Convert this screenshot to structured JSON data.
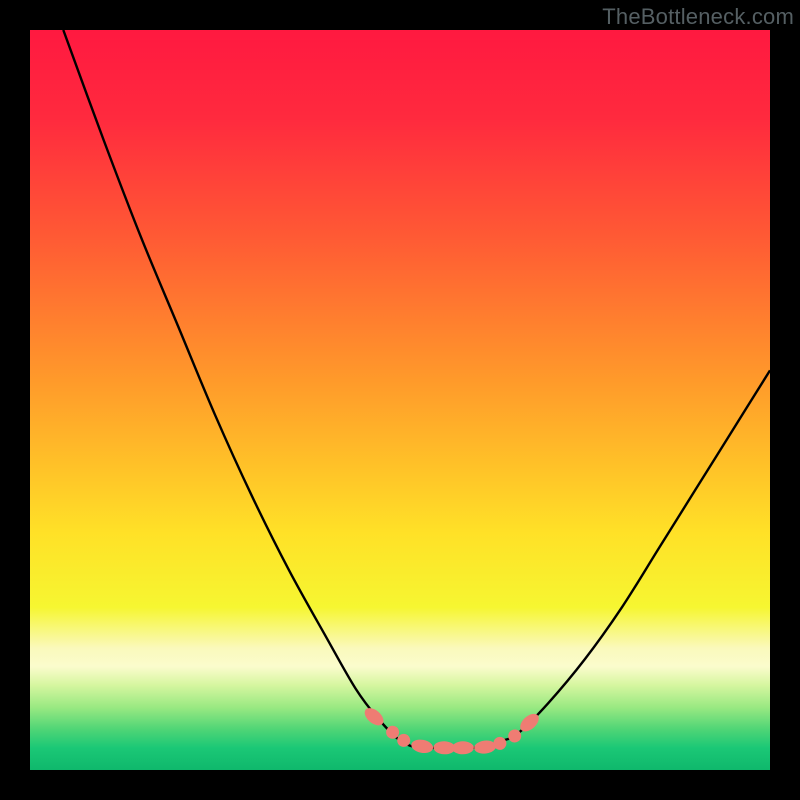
{
  "watermark": "TheBottleneck.com",
  "colors": {
    "frame": "#000000",
    "gradient_stops": [
      {
        "offset": 0.0,
        "color": "#ff1940"
      },
      {
        "offset": 0.12,
        "color": "#ff2a3e"
      },
      {
        "offset": 0.28,
        "color": "#ff5a34"
      },
      {
        "offset": 0.48,
        "color": "#ff9c2a"
      },
      {
        "offset": 0.68,
        "color": "#ffe127"
      },
      {
        "offset": 0.78,
        "color": "#f6f631"
      },
      {
        "offset": 0.835,
        "color": "#faf9bb"
      },
      {
        "offset": 0.86,
        "color": "#fbfccd"
      },
      {
        "offset": 0.885,
        "color": "#d6f6a0"
      },
      {
        "offset": 0.915,
        "color": "#9ae982"
      },
      {
        "offset": 0.945,
        "color": "#4fd576"
      },
      {
        "offset": 0.97,
        "color": "#1bc876"
      },
      {
        "offset": 1.0,
        "color": "#0fb86c"
      }
    ],
    "curve": "#000000",
    "marker_fill": "#ef7c73",
    "marker_stroke": "#c45a55"
  },
  "chart_data": {
    "type": "line",
    "title": "",
    "xlabel": "",
    "ylabel": "",
    "xlim": [
      0,
      100
    ],
    "ylim": [
      0,
      100
    ],
    "series": [
      {
        "name": "bottleneck-curve",
        "x": [
          4.5,
          10,
          15,
          20,
          25,
          30,
          35,
          40,
          44,
          47,
          50,
          52.5,
          55,
          60,
          64,
          66,
          70,
          75,
          80,
          85,
          90,
          95,
          100
        ],
        "y": [
          100,
          85,
          72,
          60,
          48,
          37,
          27,
          18,
          11,
          7,
          4,
          3,
          3,
          3,
          4,
          5,
          9,
          15,
          22,
          30,
          38,
          46,
          54
        ]
      }
    ],
    "markers": {
      "name": "highlight-points",
      "x": [
        46.5,
        49,
        50.5,
        53,
        56,
        58.5,
        61.5,
        63.5,
        65.5,
        67.5
      ],
      "y": [
        7.2,
        5.1,
        4.0,
        3.2,
        3.0,
        3.0,
        3.1,
        3.6,
        4.6,
        6.4
      ]
    },
    "notes": "Values estimated from pixels; axes unlabeled in source."
  }
}
